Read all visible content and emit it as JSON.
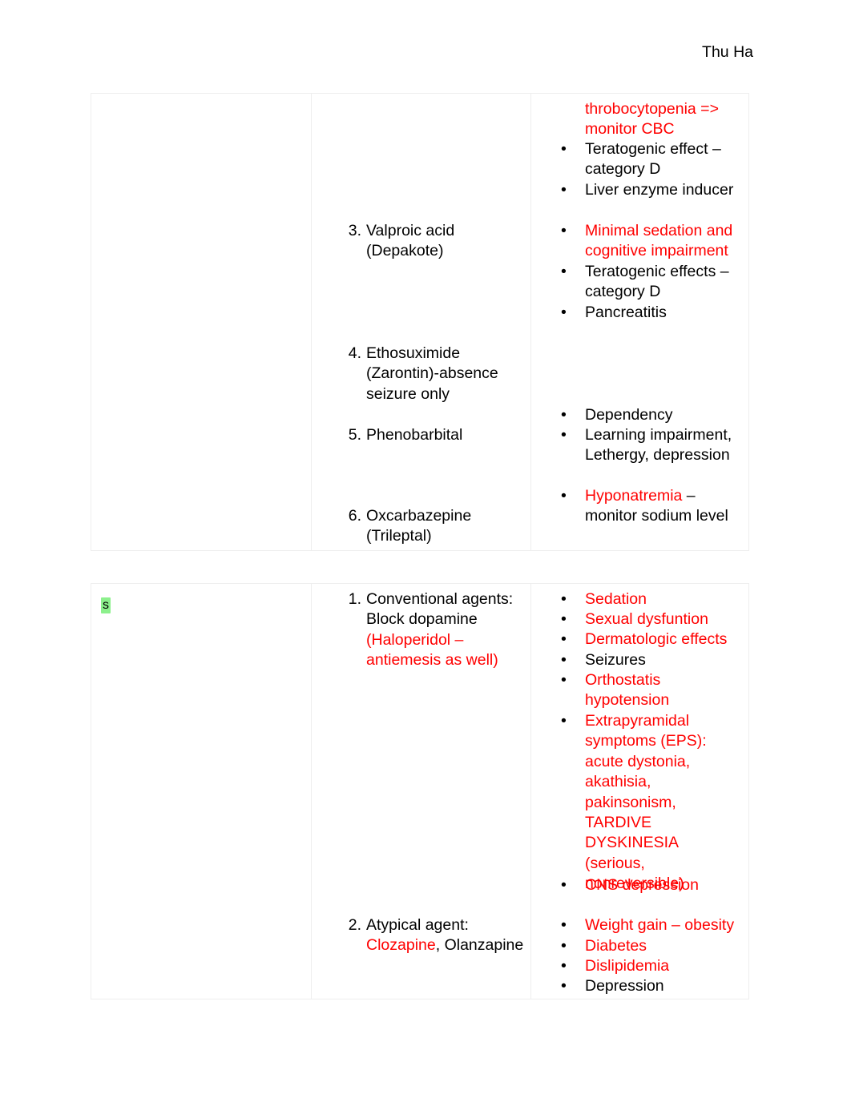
{
  "header": {
    "author": "Thu Ha"
  },
  "colors": {
    "red": "#ff0000",
    "black": "#000000",
    "highlight_green": "#8cf08c",
    "table_border": "#eeeeee"
  },
  "table1": {
    "left_column": {
      "content": ""
    },
    "drugs": [
      {
        "number": "3.",
        "name_line1": "Valproic acid",
        "name_line2": "(Depakote)"
      },
      {
        "number": "4.",
        "name_line1": "Ethosuximide",
        "name_line2": "(Zarontin)-absence",
        "name_line3": "seizure only"
      },
      {
        "number": "5.",
        "name_line1": "Phenobarbital"
      },
      {
        "number": "6.",
        "name_line1": "Oxcarbazepine",
        "name_line2": "(Trileptal)"
      }
    ],
    "effects": [
      {
        "bullet": false,
        "color": "red",
        "line1": "throbocytopenia =>",
        "line2": "monitor CBC"
      },
      {
        "bullet": true,
        "color": "black",
        "line1": "Teratogenic effect –",
        "line2": "category D"
      },
      {
        "bullet": true,
        "color": "black",
        "line1": "Liver enzyme inducer"
      },
      {
        "bullet": true,
        "color": "red",
        "line1": "Minimal sedation and",
        "line2": "cognitive impairment"
      },
      {
        "bullet": true,
        "color": "black",
        "line1": "Teratogenic effects –",
        "line2": "category D"
      },
      {
        "bullet": true,
        "color": "black",
        "line1": "Pancreatitis"
      },
      {
        "bullet": true,
        "color": "black",
        "line1": "Dependency"
      },
      {
        "bullet": true,
        "color": "black",
        "line1": "Learning impairment,",
        "line2": "Lethergy, depression"
      },
      {
        "bullet": true,
        "color": "mixed",
        "line1_red": "Hyponatremia",
        "line1_black": " –",
        "line2": "monitor sodium level"
      }
    ]
  },
  "table2": {
    "left_column": {
      "highlighted_char": "s"
    },
    "agents": [
      {
        "number": "1.",
        "line1": "Conventional agents:",
        "line2": "Block dopamine",
        "line3_red": "(Haloperidol –",
        "line4_red": "antiemesis as well)"
      },
      {
        "number": "2.",
        "line1": "Atypical agent:",
        "line2_red": "Clozapine",
        "line2_black": ", Olanzapine"
      }
    ],
    "effects_conventional": [
      {
        "bullet": true,
        "color": "red",
        "line1": "Sedation"
      },
      {
        "bullet": true,
        "color": "red",
        "line1": "Sexual dysfuntion"
      },
      {
        "bullet": true,
        "color": "red",
        "line1": "Dermatologic effects"
      },
      {
        "bullet": true,
        "color": "black",
        "line1": "Seizures"
      },
      {
        "bullet": true,
        "color": "red",
        "line1": "Orthostatis",
        "line2": "hypotension"
      },
      {
        "bullet": true,
        "color": "red",
        "line1": "Extrapyramidal",
        "line2": "symptoms (EPS):",
        "line3": "acute dystonia,",
        "line4": "akathisia,",
        "line5": "pakinsonism,",
        "line6": "TARDIVE DYSKINESIA",
        "line7": "(serious,",
        "line8": "nonreversible)"
      },
      {
        "bullet": true,
        "color": "red",
        "line1": "CNS depression"
      }
    ],
    "effects_atypical": [
      {
        "bullet": true,
        "color": "red",
        "line1": "Weight gain – obesity"
      },
      {
        "bullet": true,
        "color": "red",
        "line1": "Diabetes"
      },
      {
        "bullet": true,
        "color": "red",
        "line1": "Dislipidemia"
      },
      {
        "bullet": true,
        "color": "black",
        "line1": "Depression"
      }
    ]
  }
}
